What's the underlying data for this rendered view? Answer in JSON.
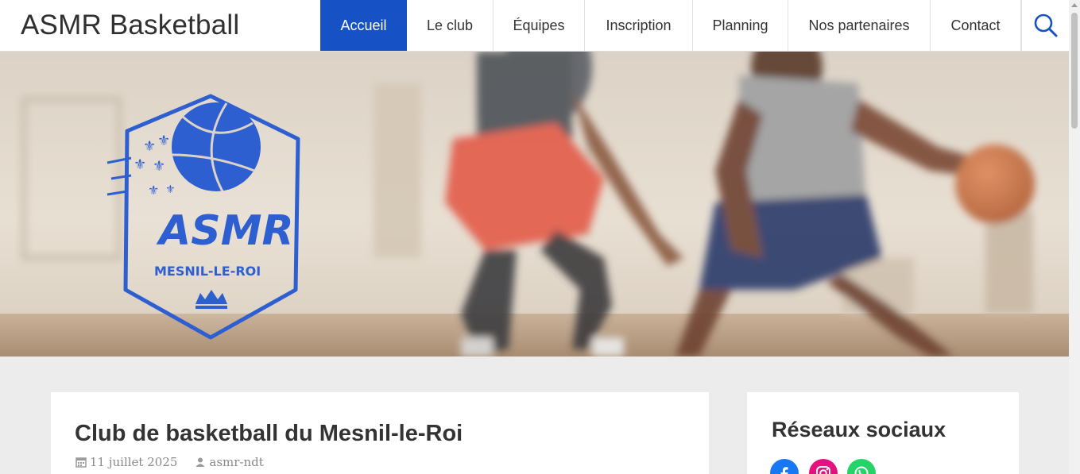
{
  "site": {
    "title": "ASMR Basketball"
  },
  "nav": {
    "items": [
      {
        "label": "Accueil",
        "active": true
      },
      {
        "label": "Le club"
      },
      {
        "label": "Équipes"
      },
      {
        "label": "Inscription"
      },
      {
        "label": "Planning"
      },
      {
        "label": "Nos partenaires"
      },
      {
        "label": "Contact"
      }
    ],
    "search_icon": "search-icon"
  },
  "hero": {
    "logo": {
      "text": "ASMR",
      "subtext": "MESNIL-LE-ROI"
    }
  },
  "post": {
    "title": "Club de basketball du Mesnil-le-Roi",
    "date": "11 juillet 2025",
    "author": "asmr-ndt"
  },
  "sidebar": {
    "title": "Réseaux sociaux",
    "socials": [
      {
        "icon": "facebook-icon",
        "color": "#1877f2"
      },
      {
        "icon": "instagram-icon",
        "color": "#e4127e"
      },
      {
        "icon": "whatsapp-icon",
        "color": "#25d366"
      }
    ]
  },
  "colors": {
    "accent": "#1652c6",
    "logo_blue": "#2e5fd1"
  }
}
